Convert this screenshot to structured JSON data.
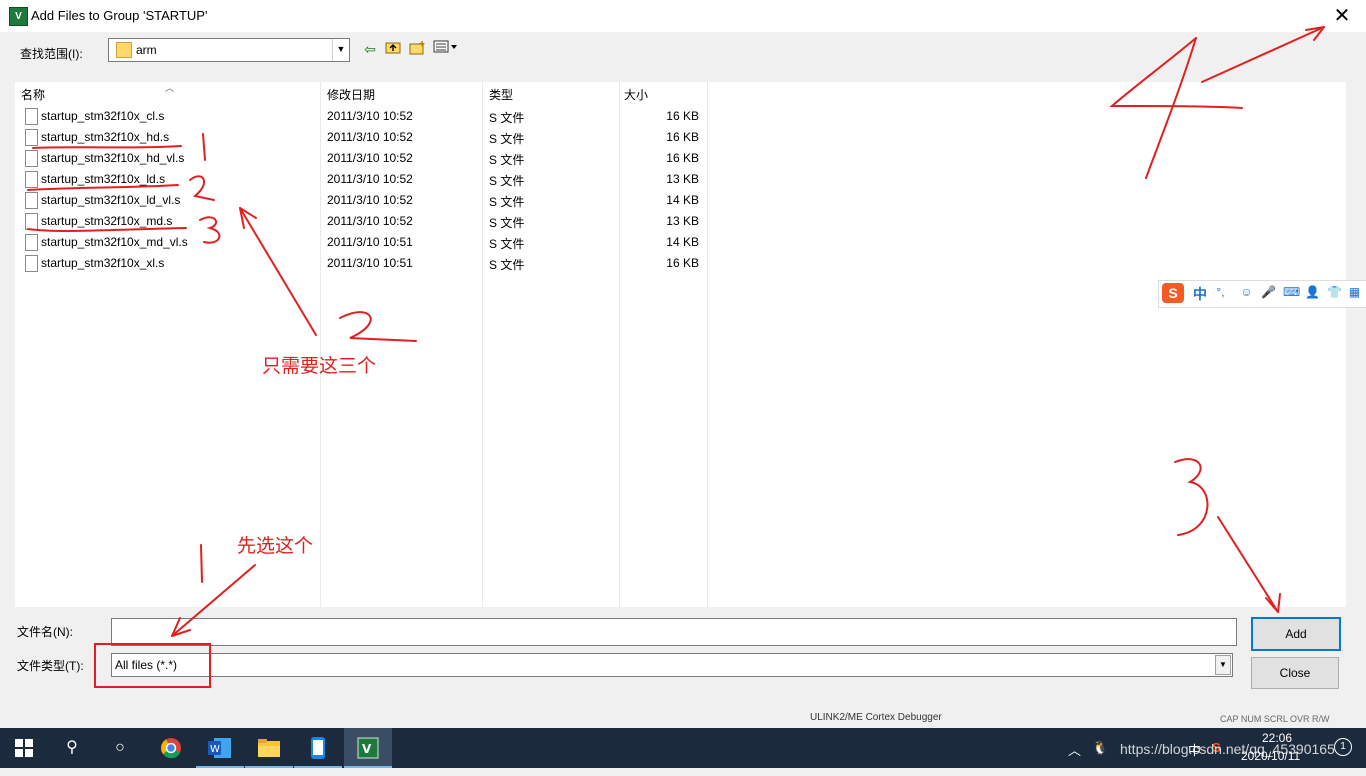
{
  "window": {
    "title": "Add Files to Group 'STARTUP'",
    "app_icon": "keil-uvision-icon",
    "close_label": "✕"
  },
  "lookin": {
    "label": "查找范围(I):",
    "value": "arm"
  },
  "toolbar": {
    "icons": [
      "back-icon",
      "up-folder-icon",
      "new-folder-icon",
      "view-menu-icon"
    ]
  },
  "columns": {
    "name": "名称",
    "modified": "修改日期",
    "type": "类型",
    "size": "大小"
  },
  "files": [
    {
      "name": "startup_stm32f10x_cl.s",
      "modified": "2011/3/10 10:52",
      "type": "S 文件",
      "size": "16 KB"
    },
    {
      "name": "startup_stm32f10x_hd.s",
      "modified": "2011/3/10 10:52",
      "type": "S 文件",
      "size": "16 KB"
    },
    {
      "name": "startup_stm32f10x_hd_vl.s",
      "modified": "2011/3/10 10:52",
      "type": "S 文件",
      "size": "16 KB"
    },
    {
      "name": "startup_stm32f10x_ld.s",
      "modified": "2011/3/10 10:52",
      "type": "S 文件",
      "size": "13 KB"
    },
    {
      "name": "startup_stm32f10x_ld_vl.s",
      "modified": "2011/3/10 10:52",
      "type": "S 文件",
      "size": "14 KB"
    },
    {
      "name": "startup_stm32f10x_md.s",
      "modified": "2011/3/10 10:52",
      "type": "S 文件",
      "size": "13 KB"
    },
    {
      "name": "startup_stm32f10x_md_vl.s",
      "modified": "2011/3/10 10:51",
      "type": "S 文件",
      "size": "14 KB"
    },
    {
      "name": "startup_stm32f10x_xl.s",
      "modified": "2011/3/10 10:51",
      "type": "S 文件",
      "size": "16 KB"
    }
  ],
  "filename": {
    "label": "文件名(N):",
    "value": ""
  },
  "filetype": {
    "label": "文件类型(T):",
    "value": "All files (*.*)"
  },
  "buttons": {
    "add": "Add",
    "close": "Close"
  },
  "background_window": {
    "status_text": "ULINK2/ME Cortex Debugger",
    "status_flags": "CAP  NUM  SCRL  OVR  R/W"
  },
  "ime_bar": {
    "lang": "中",
    "logo": "S",
    "icons": [
      "punctuation-icon",
      "emoji-icon",
      "microphone-icon",
      "keyboard-icon",
      "user-icon",
      "skin-icon",
      "grid-icon"
    ]
  },
  "annotations": {
    "choose_first": "先选这个",
    "only_need_three": "只需要这三个",
    "step1": "1",
    "step2": "2",
    "step3": "3",
    "step4": "4"
  },
  "taskbar": {
    "apps": [
      "start-icon",
      "search-icon",
      "task-view-icon",
      "chrome-icon",
      "word-icon",
      "file-explorer-icon",
      "phone-icon",
      "keil-icon"
    ],
    "tray_lang": "中",
    "time": "22:06",
    "date": "2020/10/11",
    "watermark": "https://blog.csdn.net/qq_45390165"
  },
  "colors": {
    "annotation_red": "#e02020",
    "taskbar": "#1b2a3c",
    "accent": "#0078d7"
  }
}
